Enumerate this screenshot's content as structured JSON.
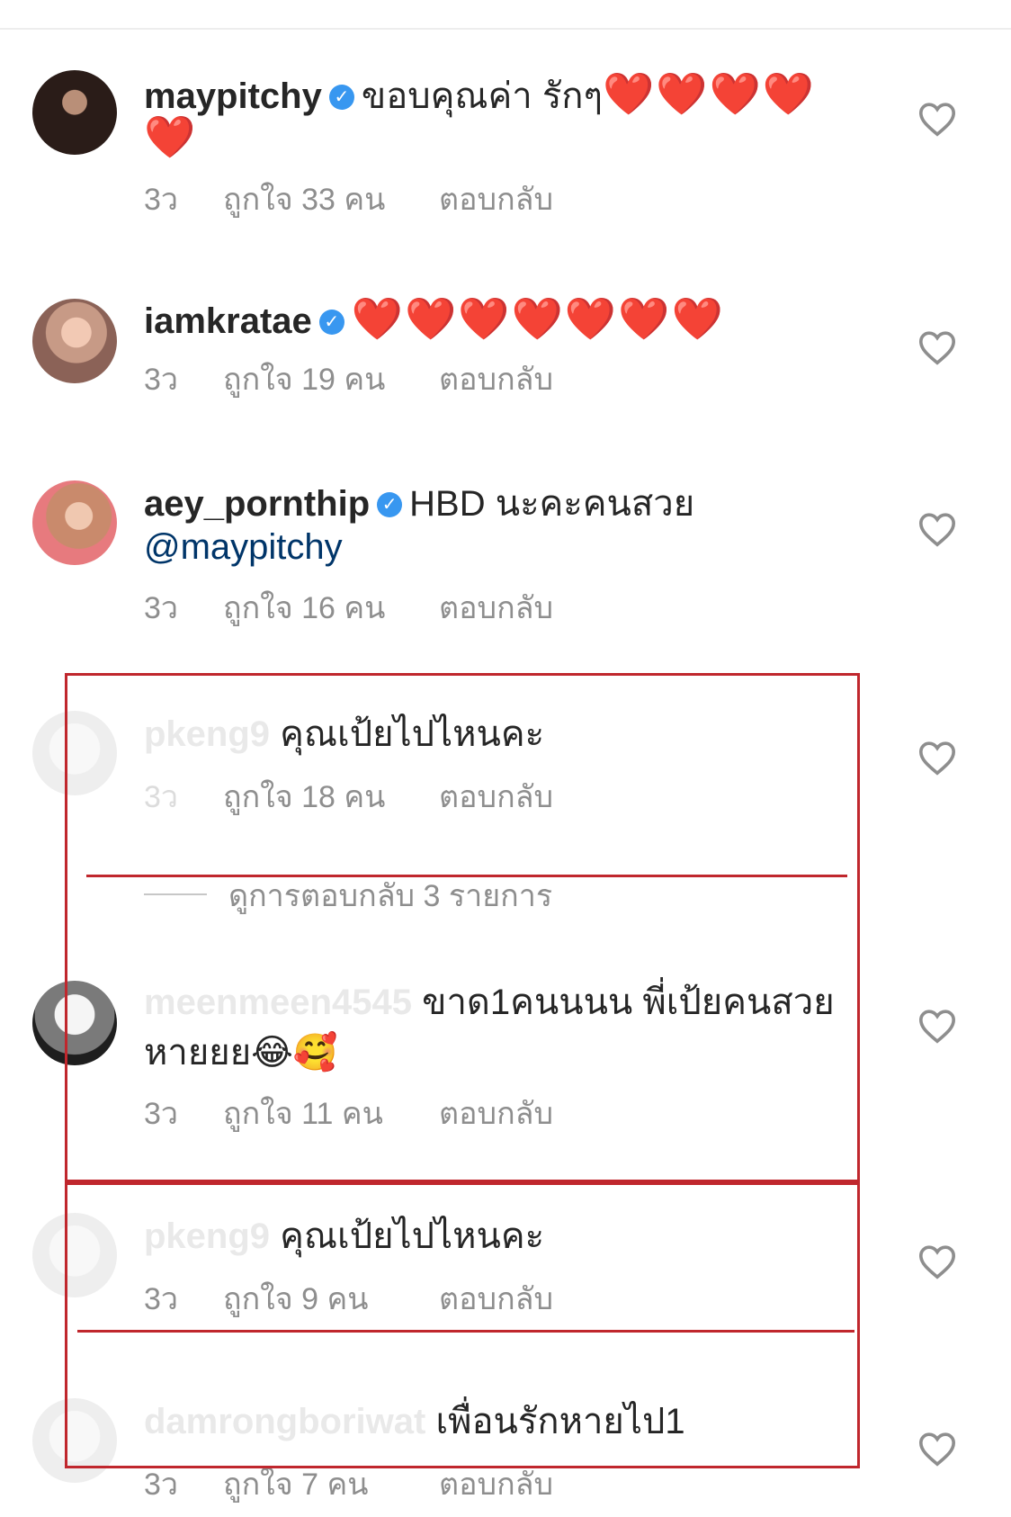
{
  "comments": [
    {
      "username": "maypitchy",
      "verified": true,
      "text": "ขอบคุณค่า รักๆ",
      "emoji": "❤️❤️❤️❤️",
      "emoji_line2": "❤️",
      "time": "3ว",
      "likes": "ถูกใจ 33 คน",
      "reply": "ตอบกลับ"
    },
    {
      "username": "iamkratae",
      "verified": true,
      "emoji": "❤️❤️❤️❤️❤️❤️❤️",
      "time": "3ว",
      "likes": "ถูกใจ 19 คน",
      "reply": "ตอบกลับ"
    },
    {
      "username": "aey_pornthip",
      "verified": true,
      "text": "HBD นะคะคนสวย",
      "mention": "@maypitchy",
      "time": "3ว",
      "likes": "ถูกใจ 16 คน",
      "reply": "ตอบกลับ"
    },
    {
      "username": "pkeng9",
      "text": "คุณเป้ยไปไหนคะ",
      "time": "3ว",
      "likes": "ถูกใจ 18 คน",
      "reply": "ตอบกลับ"
    },
    {
      "username": "meenmeen4545",
      "text": "ขาด1คนนนน พี่เป้ยคนสวย",
      "text_line2": "หายยย",
      "emoji_line2": "😂🥰",
      "time": "3ว",
      "likes": "ถูกใจ 11 คน",
      "reply": "ตอบกลับ"
    },
    {
      "username": "pkeng9",
      "text": "คุณเป้ยไปไหนคะ",
      "time": "3ว",
      "likes": "ถูกใจ 9 คน",
      "reply": "ตอบกลับ"
    },
    {
      "username": "damrongboriwat",
      "text": "เพื่อนรักหายไป1",
      "time": "3ว",
      "likes": "ถูกใจ 7 คน",
      "reply": "ตอบกลับ"
    }
  ],
  "view_replies": "ดูการตอบกลับ 3 รายการ",
  "icons": {
    "like": "heart-outline-icon",
    "verified": "verified-badge-icon"
  },
  "colors": {
    "annotation": "#c0272d",
    "verified": "#3897f0",
    "mention": "#003569",
    "meta": "#8e8e8e"
  }
}
